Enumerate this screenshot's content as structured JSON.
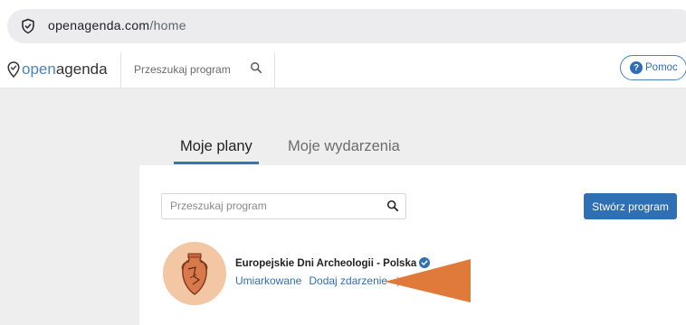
{
  "browser": {
    "url_domain": "openagenda.com",
    "url_path": "/home"
  },
  "header": {
    "logo_open": "open",
    "logo_agenda": "agenda",
    "search_placeholder": "Przeszukaj program",
    "help_label": "Pomoc",
    "help_icon_glyph": "?"
  },
  "tabs": [
    {
      "label": "Moje plany",
      "active": true
    },
    {
      "label": "Moje wydarzenia",
      "active": false
    }
  ],
  "card": {
    "search_placeholder": "Przeszukaj program",
    "create_label": "Stwórz program"
  },
  "agenda": {
    "title": "Europejskie Dni Archeologii - Polska",
    "links": [
      "Umiarkowane",
      "Dodaj zdarzenie"
    ],
    "link_separator": "|"
  },
  "colors": {
    "accent": "#2f6fb3",
    "arrow": "#e07a3a",
    "avatar_bg": "#f3c6a4"
  }
}
